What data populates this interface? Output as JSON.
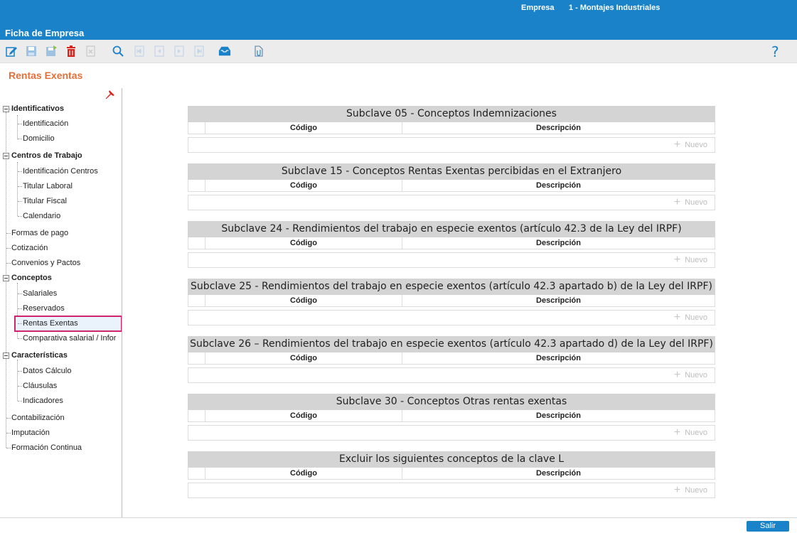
{
  "header": {
    "empresa_label": "Empresa",
    "empresa_value": "1 - Montajes Industriales",
    "app_title": "Ficha de Empresa",
    "color": "#1a82c8"
  },
  "toolbar": {
    "icons": [
      "edit-icon",
      "save-icon",
      "save-as-icon",
      "delete-icon",
      "cancel-icon",
      "search-icon",
      "first-record-icon",
      "previous-record-icon",
      "next-record-icon",
      "last-record-icon",
      "inbox-icon",
      "attachment-icon"
    ],
    "help_label": "?"
  },
  "section_title": "Rentas Exentas",
  "sidebar": {
    "groups": [
      {
        "label": "Identificativos",
        "items": [
          "Identificación",
          "Domicilio"
        ]
      },
      {
        "label": "Centros de Trabajo",
        "items": [
          "Identificación Centros",
          "Titular Laboral",
          "Titular Fiscal",
          "Calendario"
        ]
      },
      {
        "label": "Formas de pago"
      },
      {
        "label": "Cotización"
      },
      {
        "label": "Convenios y Pactos"
      },
      {
        "label": "Conceptos",
        "items": [
          "Salariales",
          "Reservados",
          "Rentas Exentas",
          "Comparativa salarial / Infor"
        ]
      },
      {
        "label": "Características",
        "items": [
          "Datos Cálculo",
          "Cláusulas",
          "Indicadores"
        ]
      },
      {
        "label": "Contabilización"
      },
      {
        "label": "Imputación"
      },
      {
        "label": "Formación Continua"
      }
    ],
    "selected": "Rentas Exentas"
  },
  "panels": [
    {
      "title": "Subclave 05 - Conceptos Indemnizaciones",
      "col_codigo": "Código",
      "col_desc": "Descripción",
      "nuevo": "Nuevo"
    },
    {
      "title": "Subclave 15 - Conceptos Rentas Exentas percibidas en el Extranjero",
      "col_codigo": "Código",
      "col_desc": "Descripción",
      "nuevo": "Nuevo"
    },
    {
      "title": "Subclave 24 - Rendimientos del trabajo en especie exentos (artículo 42.3 de la Ley del IRPF)",
      "col_codigo": "Código",
      "col_desc": "Descripción",
      "nuevo": "Nuevo"
    },
    {
      "title": "Subclave 25 - Rendimientos del trabajo en especie exentos (artículo 42.3 apartado b) de la Ley del IRPF)",
      "col_codigo": "Código",
      "col_desc": "Descripción",
      "nuevo": "Nuevo"
    },
    {
      "title": "Subclave 26 – Rendimientos del trabajo en especie exentos (artículo 42.3 apartado d) de la Ley del IRPF)",
      "col_codigo": "Código",
      "col_desc": "Descripción",
      "nuevo": "Nuevo"
    },
    {
      "title": "Subclave 30 - Conceptos Otras rentas exentas",
      "col_codigo": "Código",
      "col_desc": "Descripción",
      "nuevo": "Nuevo"
    },
    {
      "title": "Excluir los siguientes conceptos de la clave L",
      "col_codigo": "Código",
      "col_desc": "Descripción",
      "nuevo": "Nuevo"
    }
  ],
  "footer": {
    "salir_label": "Salir"
  }
}
